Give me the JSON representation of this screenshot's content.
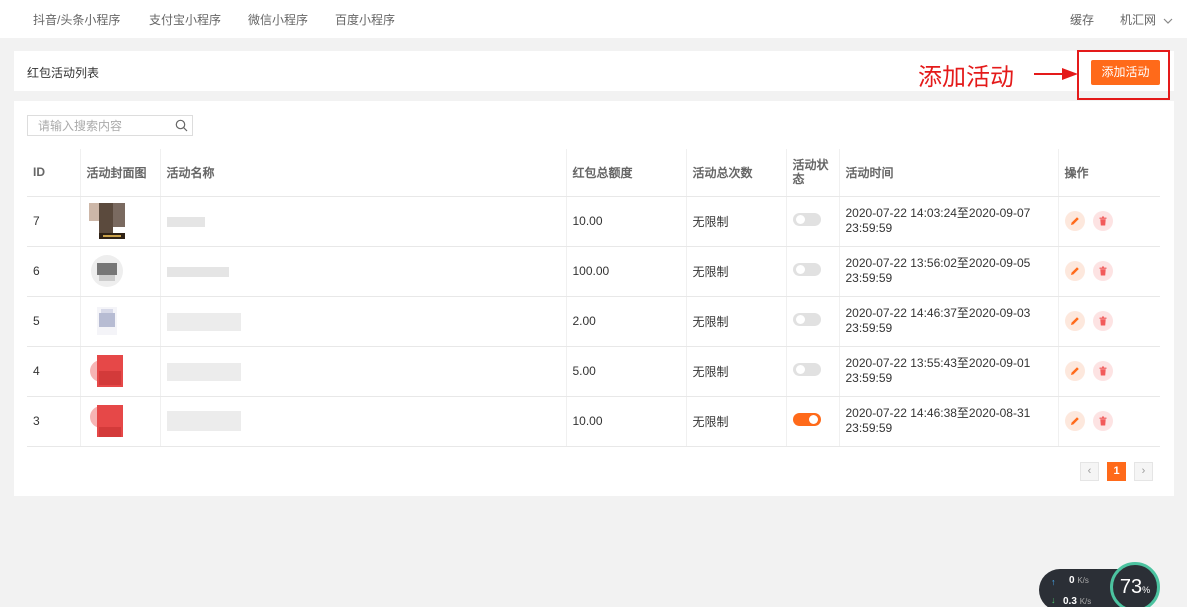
{
  "nav": {
    "items": [
      "抖音/头条小程序",
      "支付宝小程序",
      "微信小程序",
      "百度小程序"
    ],
    "cache": "缓存",
    "user": "机汇网"
  },
  "header": {
    "title": "红包活动列表",
    "add_button": "添加活动",
    "annotation": "添加活动"
  },
  "search": {
    "placeholder": "请输入搜索内容"
  },
  "table": {
    "columns": [
      "ID",
      "活动封面图",
      "活动名称",
      "红包总额度",
      "活动总次数",
      "活动状态",
      "活动时间",
      "操作"
    ],
    "rows": [
      {
        "id": "7",
        "amount": "10.00",
        "count": "无限制",
        "status": false,
        "time": "2020-07-22 14:03:24至2020-09-07 23:59:59"
      },
      {
        "id": "6",
        "amount": "100.00",
        "count": "无限制",
        "status": false,
        "time": "2020-07-22 13:56:02至2020-09-05 23:59:59"
      },
      {
        "id": "5",
        "amount": "2.00",
        "count": "无限制",
        "status": false,
        "time": "2020-07-22 14:46:37至2020-09-03 23:59:59"
      },
      {
        "id": "4",
        "amount": "5.00",
        "count": "无限制",
        "status": false,
        "time": "2020-07-22 13:55:43至2020-09-01 23:59:59"
      },
      {
        "id": "3",
        "amount": "10.00",
        "count": "无限制",
        "status": true,
        "time": "2020-07-22 14:46:38至2020-08-31 23:59:59"
      }
    ]
  },
  "pagination": {
    "current": "1",
    "prev": "‹",
    "next": "›"
  },
  "widget": {
    "up_rate": "0",
    "up_unit": "K/s",
    "down_rate": "0.3",
    "down_unit": "K/s",
    "percent": "73",
    "percent_unit": "%"
  },
  "colors": {
    "accent": "#ff6a1a",
    "annotation": "#e41a1a",
    "switch_off": "#e1e1e1"
  }
}
